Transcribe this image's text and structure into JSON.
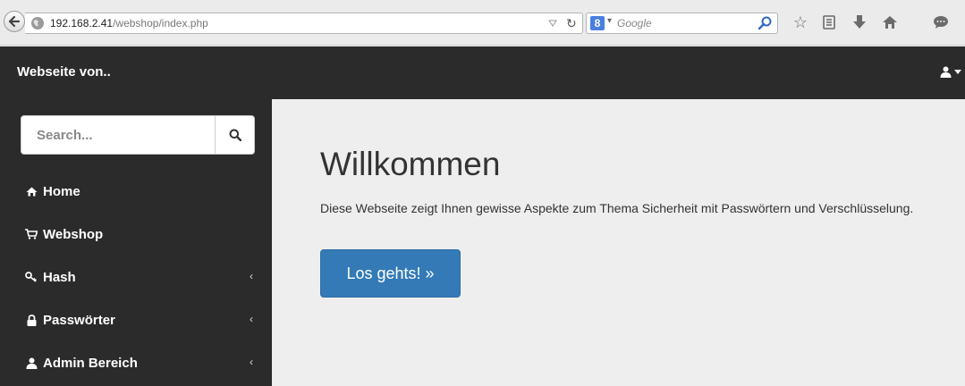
{
  "browser": {
    "url_host": "192.168.2.41",
    "url_path": "/webshop/index.php",
    "search_placeholder": "Google"
  },
  "navbar": {
    "brand": "Webseite von..",
    "user_icon": "user-icon"
  },
  "sidebar": {
    "search_placeholder": "Search...",
    "items": [
      {
        "label": "Home",
        "icon": "home-icon"
      },
      {
        "label": "Webshop",
        "icon": "cart-icon"
      },
      {
        "label": "Hash",
        "icon": "key-icon",
        "chevron": "‹"
      },
      {
        "label": "Passwörter",
        "icon": "lock-icon",
        "chevron": "‹"
      },
      {
        "label": "Admin Bereich",
        "icon": "user-icon",
        "chevron": "‹"
      }
    ]
  },
  "main": {
    "title": "Willkommen",
    "lead": "Diese Webseite zeigt Ihnen gewisse Aspekte zum Thema Sicherheit mit Passwörtern und Verschlüsselung.",
    "button": "Los gehts! »"
  },
  "colors": {
    "navbar_bg": "#2b2b2b",
    "main_bg": "#eeeeee",
    "primary": "#337ab7"
  }
}
